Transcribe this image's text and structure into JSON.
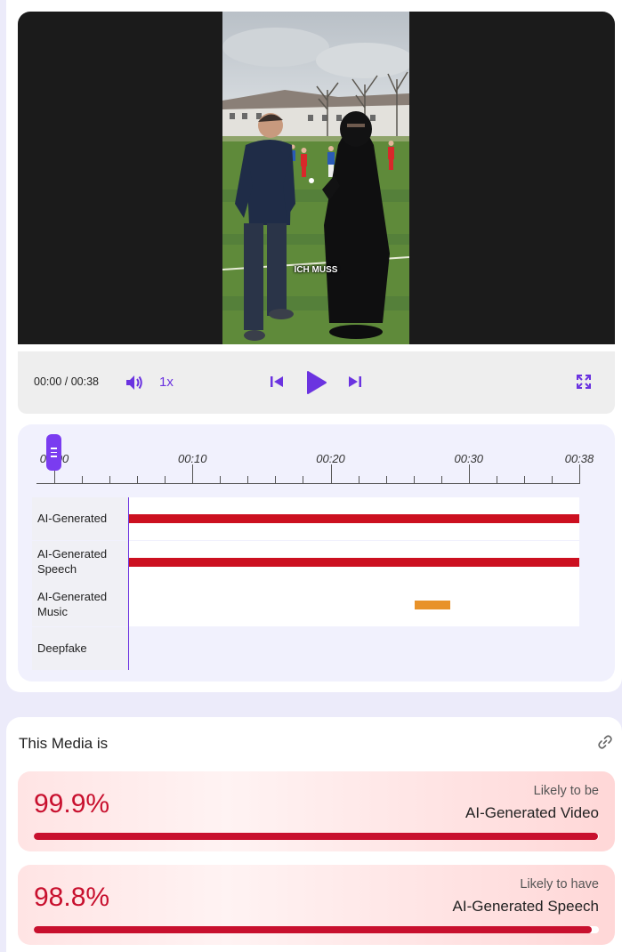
{
  "video": {
    "caption": "ICH MUSS"
  },
  "controls": {
    "time": "00:00 / 00:38",
    "volume_icon": "volume-icon",
    "speed": "1x",
    "prev_icon": "skip-back-icon",
    "play_icon": "play-icon",
    "next_icon": "skip-forward-icon",
    "fullscreen_icon": "fullscreen-icon"
  },
  "timeline": {
    "duration_seconds": 38,
    "tick_labels": [
      "00:00",
      "00:10",
      "00:20",
      "00:30",
      "00:38"
    ],
    "playhead_seconds": 0,
    "tracks": [
      {
        "label": "AI-Generated",
        "segments": [
          [
            0,
            38
          ]
        ],
        "color": "#cc1020"
      },
      {
        "label": "AI-Generated Speech",
        "segments": [
          [
            0,
            38
          ]
        ],
        "color": "#cc1020"
      },
      {
        "label": "AI-Generated Music",
        "segments": [
          [
            24.1,
            27.1
          ]
        ],
        "color": "#e8922a"
      },
      {
        "label": "Deepfake",
        "segments": [],
        "color": "#cc1020"
      }
    ]
  },
  "results": {
    "title": "This Media is",
    "link_icon": "link-icon",
    "items": [
      {
        "percent": "99.9%",
        "fraction": 0.999,
        "sub": "Likely to be",
        "main": "AI-Generated Video"
      },
      {
        "percent": "98.8%",
        "fraction": 0.988,
        "sub": "Likely to have",
        "main": "AI-Generated Speech"
      }
    ]
  },
  "colors": {
    "accent": "#6b33e0",
    "danger": "#c8102e",
    "music": "#e8922a"
  }
}
